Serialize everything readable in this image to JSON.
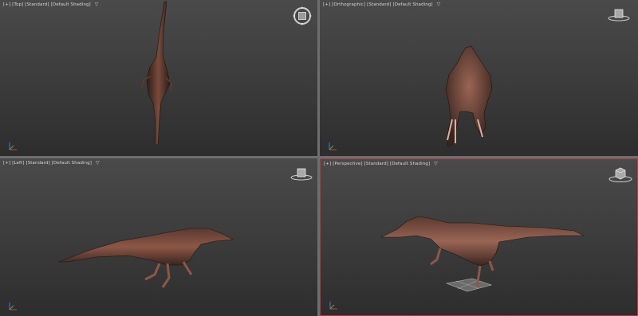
{
  "viewports": [
    {
      "id": "top",
      "plus": "[+]",
      "view": "[Top]",
      "shading_style": "[Standard]",
      "shading": "[Default Shading]",
      "active": false
    },
    {
      "id": "front",
      "plus": "[+]",
      "view": "[Orthographic]",
      "shading_style": "[Standard]",
      "shading": "[Default Shading]",
      "active": false
    },
    {
      "id": "left",
      "plus": "[+]",
      "view": "[Left]",
      "shading_style": "[Standard]",
      "shading": "[Default Shading]",
      "active": false
    },
    {
      "id": "perspective",
      "plus": "[+]",
      "view": "[Perspective]",
      "shading_style": "[Standard]",
      "shading": "[Default Shading]",
      "active": true
    }
  ],
  "filter_icon": "funnel-icon",
  "gizmo_icons": {
    "top": "steering-wheel-icon",
    "others": "viewcube-icon"
  },
  "colors": {
    "active_border": "#b03a48",
    "viewport_bg": "#3b3b3b",
    "separator": "#6e6e6e",
    "model": "#6b4034"
  }
}
